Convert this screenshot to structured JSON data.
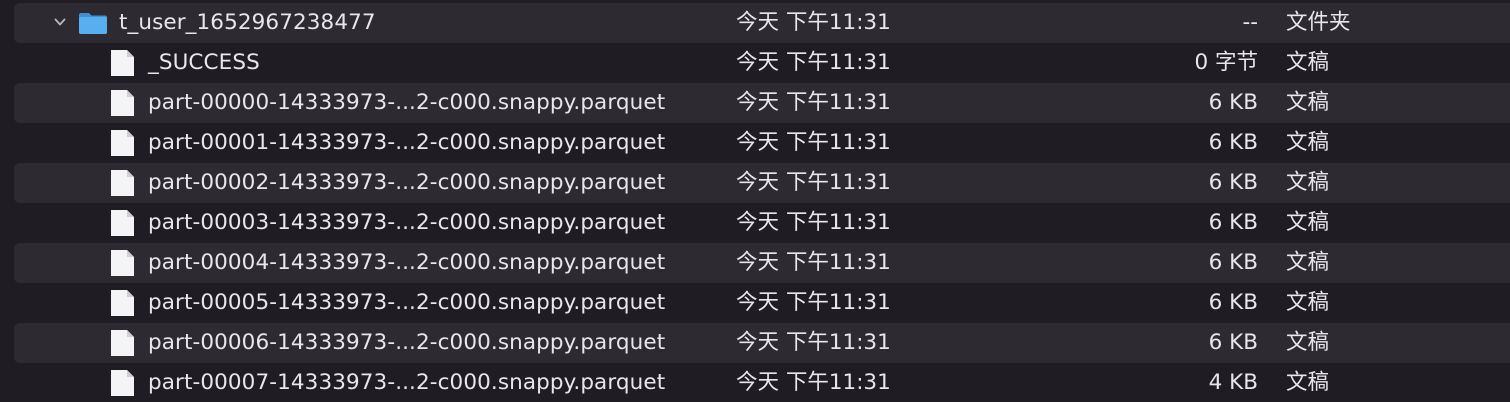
{
  "folder": {
    "name": "t_user_1652967238477",
    "date": "今天 下午11:31",
    "size": "--",
    "kind": "文件夹",
    "icon": "folder-icon",
    "expanded": true
  },
  "files": [
    {
      "name": "_SUCCESS",
      "date": "今天 下午11:31",
      "size": "0 字节",
      "kind": "文稿",
      "icon": "document-icon"
    },
    {
      "name": "part-00000-14333973-...2-c000.snappy.parquet",
      "date": "今天 下午11:31",
      "size": "6 KB",
      "kind": "文稿",
      "icon": "document-icon"
    },
    {
      "name": "part-00001-14333973-...2-c000.snappy.parquet",
      "date": "今天 下午11:31",
      "size": "6 KB",
      "kind": "文稿",
      "icon": "document-icon"
    },
    {
      "name": "part-00002-14333973-...2-c000.snappy.parquet",
      "date": "今天 下午11:31",
      "size": "6 KB",
      "kind": "文稿",
      "icon": "document-icon"
    },
    {
      "name": "part-00003-14333973-...2-c000.snappy.parquet",
      "date": "今天 下午11:31",
      "size": "6 KB",
      "kind": "文稿",
      "icon": "document-icon"
    },
    {
      "name": "part-00004-14333973-...2-c000.snappy.parquet",
      "date": "今天 下午11:31",
      "size": "6 KB",
      "kind": "文稿",
      "icon": "document-icon"
    },
    {
      "name": "part-00005-14333973-...2-c000.snappy.parquet",
      "date": "今天 下午11:31",
      "size": "6 KB",
      "kind": "文稿",
      "icon": "document-icon"
    },
    {
      "name": "part-00006-14333973-...2-c000.snappy.parquet",
      "date": "今天 下午11:31",
      "size": "6 KB",
      "kind": "文稿",
      "icon": "document-icon"
    },
    {
      "name": "part-00007-14333973-...2-c000.snappy.parquet",
      "date": "今天 下午11:31",
      "size": "4 KB",
      "kind": "文稿",
      "icon": "document-icon"
    }
  ],
  "colors": {
    "background": "#1f1d23",
    "row_alt": "#2d2b31",
    "text": "#e8e6ea",
    "folder_blue": "#4aa3e8"
  }
}
